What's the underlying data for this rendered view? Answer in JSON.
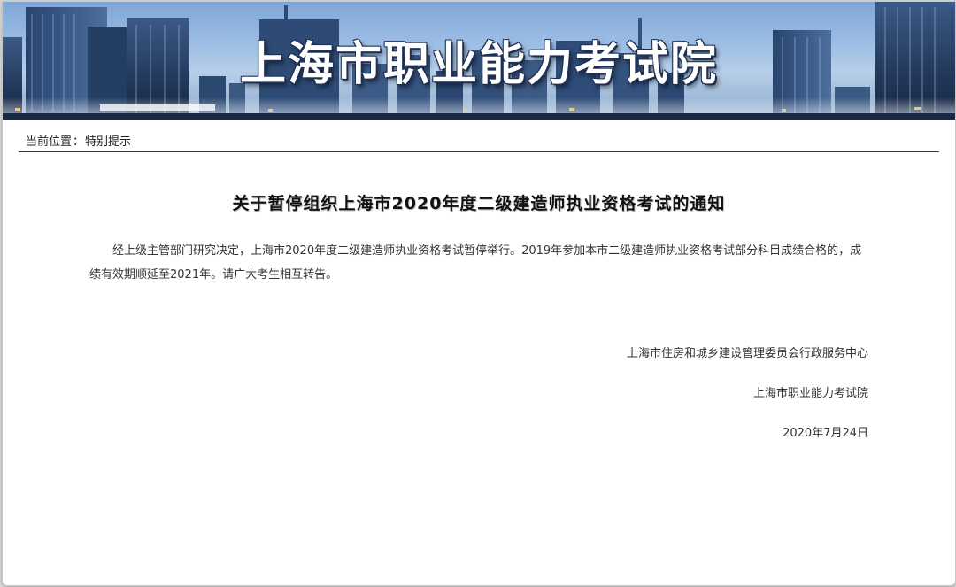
{
  "banner": {
    "title": "上海市职业能力考试院"
  },
  "breadcrumb": {
    "label": "当前位置",
    "separator": "：",
    "current": "特别提示"
  },
  "article": {
    "title": "关于暂停组织上海市2020年度二级建造师执业资格考试的通知",
    "body": "经上级主管部门研究决定，上海市2020年度二级建造师执业资格考试暂停举行。2019年参加本市二级建造师执业资格考试部分科目成绩合格的，成绩有效期顺延至2021年。请广大考生相互转告。",
    "signature_org1": "上海市住房和城乡建设管理委员会行政服务中心",
    "signature_org2": "上海市职业能力考试院",
    "date": "2020年7月24日"
  },
  "colors": {
    "banner_sky": "#9cbde4",
    "building_dark": "#1f3556",
    "text": "#333333",
    "title_text": "#111111"
  }
}
